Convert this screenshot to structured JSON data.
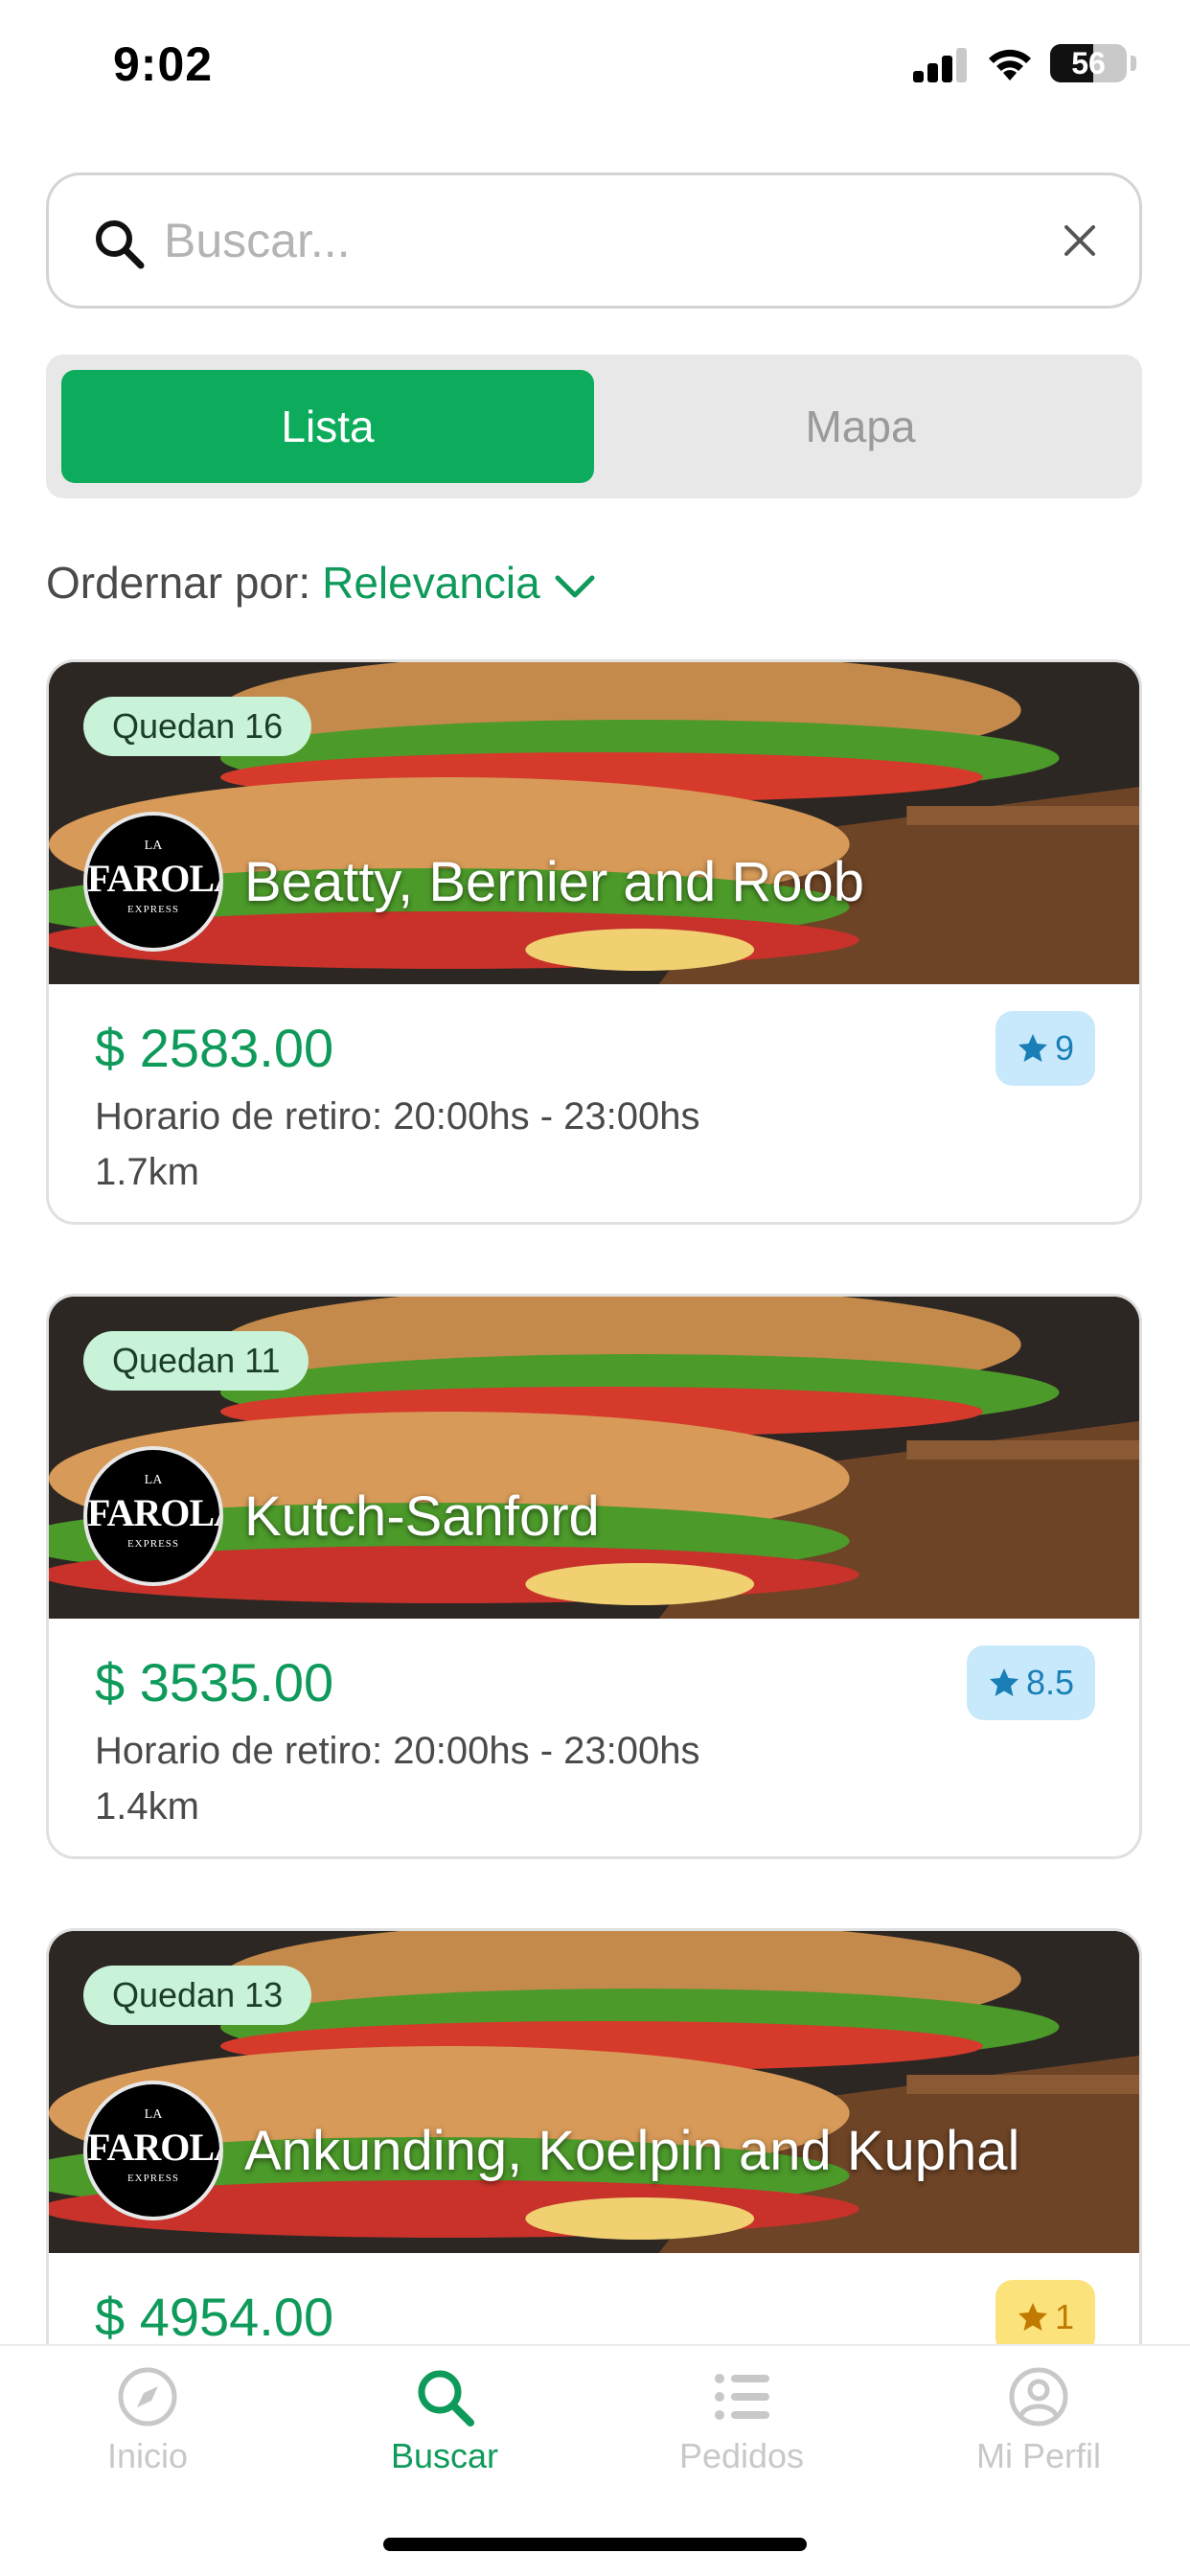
{
  "status_bar": {
    "time": "9:02",
    "battery": "56"
  },
  "search": {
    "placeholder": "Buscar...",
    "value": ""
  },
  "view_tabs": [
    {
      "label": "Lista",
      "active": true
    },
    {
      "label": "Mapa",
      "active": false
    }
  ],
  "sort": {
    "label": "Ordernar por:",
    "value": "Relevancia"
  },
  "cards": [
    {
      "remaining": "Quedan 16",
      "name": "Beatty, Bernier and Roob",
      "price": "$ 2583.00",
      "pickup": "Horario de retiro: 20:00hs - 23:00hs",
      "distance": "1.7km",
      "rating": "9",
      "rating_color": "#c7e9fb"
    },
    {
      "remaining": "Quedan 11",
      "name": "Kutch-Sanford",
      "price": "$ 3535.00",
      "pickup": "Horario de retiro: 20:00hs - 23:00hs",
      "distance": "1.4km",
      "rating": "8.5",
      "rating_color": "#c7e9fb"
    },
    {
      "remaining": "Quedan 13",
      "name": "Ankunding, Koelpin and Kuphal",
      "price": "$ 4954.00",
      "pickup": "",
      "distance": "",
      "rating": "1",
      "rating_color": "#fbe27a"
    }
  ],
  "logo": {
    "top": "LA",
    "main": "FAROLA",
    "sub": "EXPRESS"
  },
  "bottom_nav": [
    {
      "label": "Inicio",
      "icon": "compass-icon",
      "active": false
    },
    {
      "label": "Buscar",
      "icon": "search-icon",
      "active": true
    },
    {
      "label": "Pedidos",
      "icon": "list-icon",
      "active": false
    },
    {
      "label": "Mi Perfil",
      "icon": "user-icon",
      "active": false
    }
  ],
  "colors": {
    "accent": "#0cac5c",
    "accent_text": "#0e9a5a",
    "badge_green": "#c8f3d8",
    "rating_blue": "#c7e9fb",
    "rating_yellow": "#fbe27a"
  }
}
